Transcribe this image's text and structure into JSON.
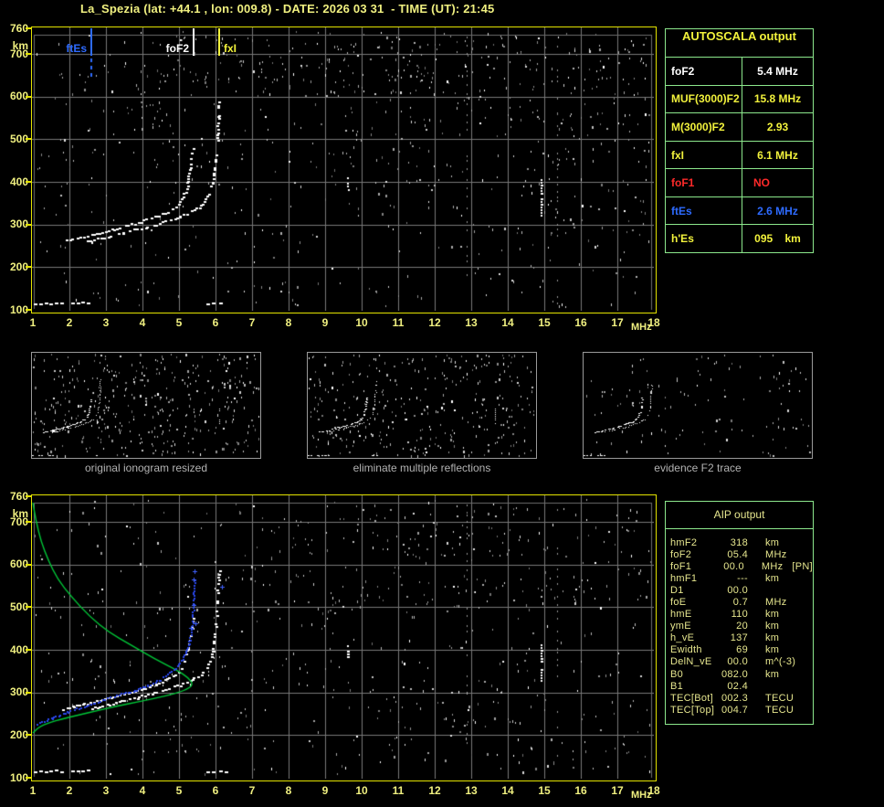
{
  "title": "La_Spezia (lat: +44.1 , lon: 009.8) - DATE: 2026 03 31  - TIME (UT): 21:45",
  "colors": {
    "yellow": "#f2f23c",
    "white": "#ffffff",
    "red": "#ff2a2a",
    "blue": "#2e6bff",
    "pale_yellow": "#f0f080",
    "table_border": "#8ce88c",
    "aip_text": "#e6e68e",
    "grid": "#787878",
    "plot_border": "#e3e300",
    "green_profile": "#00c838",
    "calc_trace_blue": "#2946e8",
    "caption_gray": "#b2b2b2"
  },
  "autoscala": {
    "header": "AUTOSCALA output",
    "rows": [
      {
        "label": "foF2",
        "value": "5.4 MHz",
        "color": "white",
        "align": "center"
      },
      {
        "label": "MUF(3000)F2",
        "value": "15.8 MHz",
        "color": "yellow",
        "align": "center"
      },
      {
        "label": "M(3000)F2",
        "value": "2.93",
        "color": "yellow",
        "align": "center"
      },
      {
        "label": "fxI",
        "value": "6.1 MHz",
        "color": "yellow",
        "align": "center"
      },
      {
        "label": "foF1",
        "value": "NO",
        "color": "red",
        "align": "left"
      },
      {
        "label": "ftEs",
        "value": "2.6 MHz",
        "color": "blue",
        "align": "center"
      },
      {
        "label": "h'Es",
        "value": "095    km",
        "color": "yellow",
        "align": "center"
      }
    ]
  },
  "aip": {
    "header": "AIP output",
    "rows": [
      {
        "name": "hmF2",
        "value": "318",
        "unit": "km",
        "extra": ""
      },
      {
        "name": "foF2",
        "value": "05.4",
        "unit": "MHz",
        "extra": ""
      },
      {
        "name": "foF1",
        "value": "00.0",
        "unit": "MHz",
        "extra": "[PN]"
      },
      {
        "name": "hmF1",
        "value": "---",
        "unit": "km",
        "extra": ""
      },
      {
        "name": "D1",
        "value": "00.0",
        "unit": "",
        "extra": ""
      },
      {
        "name": "foE",
        "value": "0.7",
        "unit": "MHz",
        "extra": ""
      },
      {
        "name": "hmE",
        "value": "110",
        "unit": "km",
        "extra": ""
      },
      {
        "name": "ymE",
        "value": "20",
        "unit": "km",
        "extra": ""
      },
      {
        "name": "h_vE",
        "value": "137",
        "unit": "km",
        "extra": ""
      },
      {
        "name": "Ewidth",
        "value": "69",
        "unit": "km",
        "extra": ""
      },
      {
        "name": "DelN_vE",
        "value": "00.0",
        "unit": "m^(-3)",
        "extra": ""
      },
      {
        "name": "B0",
        "value": "082.0",
        "unit": "km",
        "extra": ""
      },
      {
        "name": "B1",
        "value": "02.4",
        "unit": "",
        "extra": ""
      },
      {
        "name": "TEC[Bot]",
        "value": "002.3",
        "unit": "TECU",
        "extra": ""
      },
      {
        "name": "TEC[Top]",
        "value": "004.7",
        "unit": "TECU",
        "extra": ""
      }
    ]
  },
  "thumbnails": [
    {
      "caption": "original ionogram resized"
    },
    {
      "caption": "eliminate multiple reflections"
    },
    {
      "caption": "evidence F2 trace"
    }
  ],
  "chart_data": {
    "type": "scatter",
    "subtype": "ionogram",
    "title": "La_Spezia ionogram 2026-03-31 21:45 UT",
    "xlabel_unit": "MHz",
    "ylabel_unit": "km",
    "xlim": [
      1,
      18
    ],
    "ylim": [
      100,
      760
    ],
    "xticks": [
      1,
      2,
      3,
      4,
      5,
      6,
      7,
      8,
      9,
      10,
      11,
      12,
      13,
      14,
      15,
      16,
      17,
      18
    ],
    "yticks": [
      760,
      700,
      600,
      500,
      400,
      300,
      200,
      100
    ],
    "grid": true,
    "markers": [
      {
        "name": "ftEs",
        "f": 2.6,
        "color_key": "blue",
        "side": "left"
      },
      {
        "name": "foF2",
        "f": 5.4,
        "color_key": "white",
        "side": "left"
      },
      {
        "name": "fxI",
        "f": 6.1,
        "color_key": "yellow",
        "side": "right"
      }
    ],
    "o_trace": [
      [
        1.82,
        262
      ],
      [
        2.1,
        268
      ],
      [
        2.4,
        274
      ],
      [
        2.8,
        282
      ],
      [
        3.2,
        291
      ],
      [
        3.6,
        300
      ],
      [
        4.0,
        310
      ],
      [
        4.35,
        320
      ],
      [
        4.65,
        331
      ],
      [
        4.9,
        344
      ],
      [
        5.05,
        360
      ],
      [
        5.15,
        378
      ],
      [
        5.22,
        400
      ],
      [
        5.28,
        428
      ],
      [
        5.33,
        455
      ],
      [
        5.36,
        480
      ]
    ],
    "x_trace": [
      [
        2.5,
        262
      ],
      [
        2.78,
        268
      ],
      [
        3.08,
        274
      ],
      [
        3.48,
        282
      ],
      [
        3.88,
        291
      ],
      [
        4.28,
        300
      ],
      [
        4.68,
        310
      ],
      [
        5.03,
        320
      ],
      [
        5.33,
        331
      ],
      [
        5.58,
        344
      ],
      [
        5.73,
        360
      ],
      [
        5.83,
        378
      ],
      [
        5.9,
        400
      ],
      [
        5.96,
        432
      ],
      [
        6.0,
        468
      ],
      [
        6.03,
        510
      ],
      [
        6.06,
        558
      ],
      [
        6.08,
        595
      ]
    ],
    "es_layer": {
      "h": 115,
      "segments": [
        [
          1.02,
          1.4
        ],
        [
          1.45,
          1.85
        ],
        [
          2.05,
          2.3
        ],
        [
          2.32,
          2.55
        ],
        [
          5.75,
          5.95
        ],
        [
          6.1,
          6.3
        ]
      ]
    },
    "interference": [
      {
        "f": 9.62,
        "h": [
          384,
          410
        ]
      },
      {
        "f": 14.93,
        "h": [
          318,
          412
        ]
      }
    ],
    "noise_columns": [
      12.88,
      15.35
    ],
    "profile": [
      [
        1.0,
        205
      ],
      [
        1.15,
        219
      ],
      [
        1.45,
        229
      ],
      [
        1.8,
        238
      ],
      [
        2.2,
        246
      ],
      [
        2.75,
        257
      ],
      [
        3.3,
        268
      ],
      [
        3.95,
        279
      ],
      [
        4.6,
        291
      ],
      [
        5.15,
        304
      ],
      [
        5.4,
        318
      ],
      [
        5.25,
        335
      ],
      [
        4.95,
        352
      ],
      [
        4.35,
        378
      ],
      [
        3.65,
        413
      ],
      [
        3.1,
        440
      ],
      [
        2.55,
        478
      ],
      [
        2.05,
        525
      ],
      [
        1.68,
        565
      ],
      [
        1.42,
        610
      ],
      [
        1.22,
        655
      ],
      [
        1.08,
        705
      ],
      [
        1.0,
        745
      ]
    ],
    "calc_trace": [
      [
        1.12,
        227
      ],
      [
        1.5,
        241
      ],
      [
        1.95,
        256
      ],
      [
        2.45,
        270
      ],
      [
        2.9,
        284
      ],
      [
        3.35,
        296
      ],
      [
        3.75,
        306
      ],
      [
        4.15,
        317
      ],
      [
        4.45,
        330
      ],
      [
        4.7,
        344
      ],
      [
        4.9,
        358
      ],
      [
        5.08,
        378
      ],
      [
        5.2,
        400
      ],
      [
        5.28,
        425
      ],
      [
        5.33,
        452
      ],
      [
        5.37,
        478
      ],
      [
        5.39,
        505
      ],
      [
        5.4,
        535
      ],
      [
        5.4,
        565
      ]
    ],
    "calc_extra_points": [
      [
        5.42,
        585
      ],
      [
        6.17,
        548
      ],
      [
        5.44,
        462
      ]
    ]
  }
}
